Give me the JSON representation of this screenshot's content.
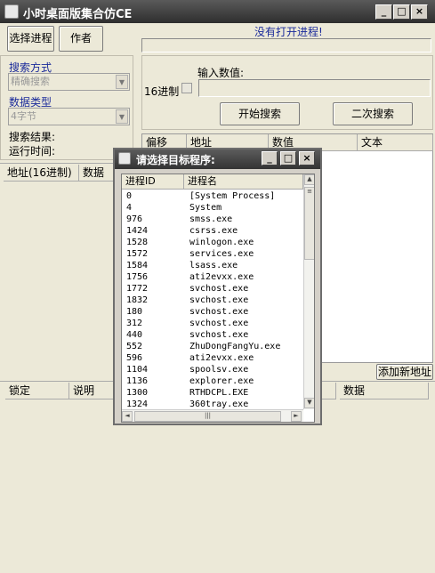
{
  "window": {
    "title": "小时桌面版集合仿CE"
  },
  "toolbar": {
    "select_process": "选择进程",
    "author": "作者"
  },
  "status": {
    "no_process": "没有打开进程!"
  },
  "search": {
    "mode_label": "搜索方式",
    "mode_value": "精确搜索",
    "type_label": "数据类型",
    "type_value": "4字节",
    "results_label": "搜索结果:",
    "run_time_label": "运行时间:",
    "hex_label": "16进制",
    "input_label": "输入数值:",
    "start_button": "开始搜索",
    "second_button": "二次搜索"
  },
  "results_table": {
    "headers": [
      "地址(16进制)",
      "数据"
    ]
  },
  "mem_table": {
    "headers": [
      "偏移",
      "地址",
      "数值",
      "文本"
    ]
  },
  "saved_table": {
    "add_button": "添加新地址",
    "headers": [
      "锁定",
      "说明",
      "数据"
    ]
  },
  "dialog": {
    "title": "请选择目标程序:",
    "headers": [
      "进程ID",
      "进程名"
    ],
    "processes": [
      {
        "pid": "0",
        "name": "[System Process]"
      },
      {
        "pid": "4",
        "name": "System"
      },
      {
        "pid": "976",
        "name": "smss.exe"
      },
      {
        "pid": "1424",
        "name": "csrss.exe"
      },
      {
        "pid": "1528",
        "name": "winlogon.exe"
      },
      {
        "pid": "1572",
        "name": "services.exe"
      },
      {
        "pid": "1584",
        "name": "lsass.exe"
      },
      {
        "pid": "1756",
        "name": "ati2evxx.exe"
      },
      {
        "pid": "1772",
        "name": "svchost.exe"
      },
      {
        "pid": "1832",
        "name": "svchost.exe"
      },
      {
        "pid": "180",
        "name": "svchost.exe"
      },
      {
        "pid": "312",
        "name": "svchost.exe"
      },
      {
        "pid": "440",
        "name": "svchost.exe"
      },
      {
        "pid": "552",
        "name": "ZhuDongFangYu.exe"
      },
      {
        "pid": "596",
        "name": "ati2evxx.exe"
      },
      {
        "pid": "1104",
        "name": "spoolsv.exe"
      },
      {
        "pid": "1136",
        "name": "explorer.exe"
      },
      {
        "pid": "1300",
        "name": "RTHDCPL.EXE"
      },
      {
        "pid": "1324",
        "name": "360tray.exe"
      }
    ]
  },
  "icons": {
    "app": "app-icon",
    "minimize": "minimize-icon",
    "maximize": "maximize-icon",
    "close": "close-icon",
    "dropdown": "chevron-down-icon"
  }
}
